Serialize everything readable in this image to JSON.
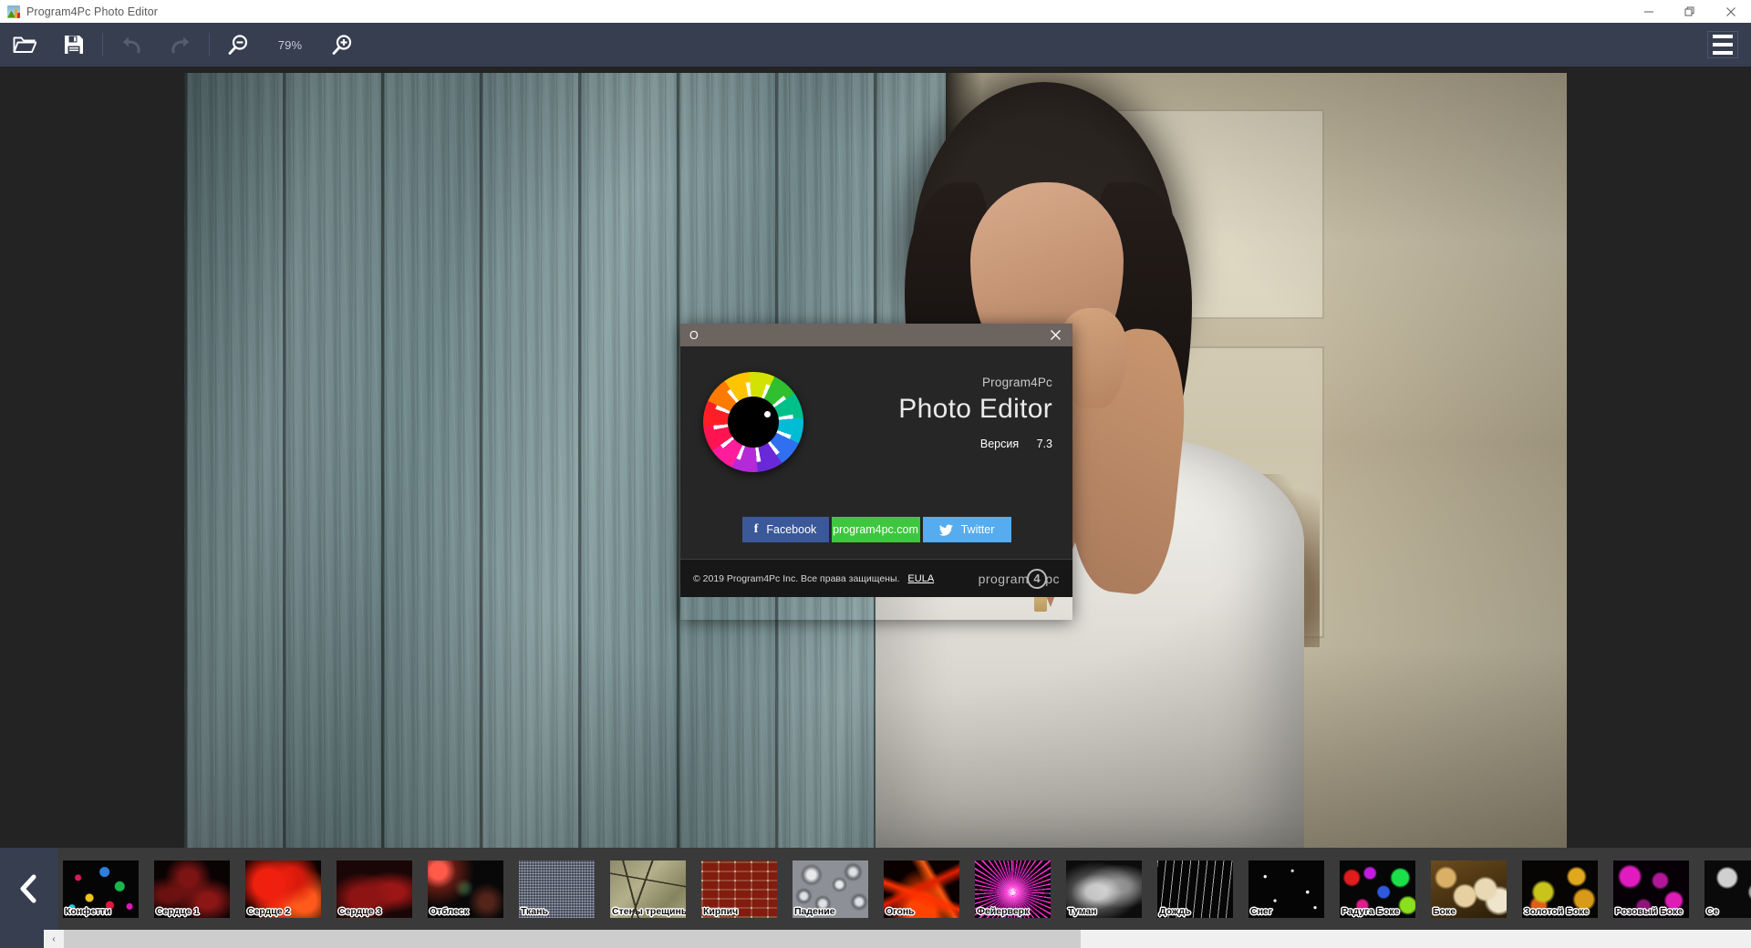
{
  "window": {
    "title": "Program4Pc Photo Editor",
    "icon": "photo-app-icon",
    "controls": {
      "minimize": "minimize-icon",
      "restore": "restore-icon",
      "close": "close-icon"
    }
  },
  "toolbar": {
    "open_label": "folder-open-icon",
    "save_label": "save-icon",
    "undo_label": "undo-icon",
    "redo_label": "redo-icon",
    "zoom_out_label": "zoom-out-icon",
    "zoom_level": "79%",
    "zoom_in_label": "zoom-in-icon",
    "menu_label": "hamburger-menu-icon"
  },
  "dialog": {
    "title": "О",
    "close_label": "✕",
    "logo": "color-wheel-eye-icon",
    "brand_small": "Program4Pc",
    "brand_big": "Photo Editor",
    "version_label": "Версия",
    "version_value": "7.3",
    "buttons": [
      {
        "name": "facebook",
        "label": "Facebook",
        "glyph": "f",
        "color": "#3b5998"
      },
      {
        "name": "website",
        "label": "program4pc.com",
        "glyph": "",
        "color": "#3ec73e"
      },
      {
        "name": "twitter",
        "label": "Twitter",
        "glyph": "🐦",
        "color": "#55acee"
      }
    ],
    "copyright": "© 2019 Program4Pc Inc. Все права защищены.",
    "eula": "EULA",
    "footer_logo_left": "program",
    "footer_logo_num": "4",
    "footer_logo_right": "pc"
  },
  "filmstrip": {
    "prev_label": "chevron-left-icon",
    "thumbs": [
      {
        "label": "Конфетти",
        "art": "t-confetti"
      },
      {
        "label": "Сердце 1",
        "art": "t-heart1"
      },
      {
        "label": "Сердце 2",
        "art": "t-heart2"
      },
      {
        "label": "Сердце 3",
        "art": "t-heart3"
      },
      {
        "label": "Отблеск",
        "art": "t-flare"
      },
      {
        "label": "Ткань",
        "art": "t-fabric"
      },
      {
        "label": "Стены трещины",
        "art": "t-cracked"
      },
      {
        "label": "Кирпич",
        "art": "t-brick"
      },
      {
        "label": "Падение",
        "art": "t-drops"
      },
      {
        "label": "Огонь",
        "art": "t-fire"
      },
      {
        "label": "Фейерверк",
        "art": "t-firework"
      },
      {
        "label": "Туман",
        "art": "t-fog"
      },
      {
        "label": "Дождь",
        "art": "t-rain"
      },
      {
        "label": "Снег",
        "art": "t-snow"
      },
      {
        "label": "Радуга Боке",
        "art": "t-rainbow-bokeh"
      },
      {
        "label": "Боке",
        "art": "t-bokeh"
      },
      {
        "label": "Золотой Боке",
        "art": "t-gold-bokeh"
      },
      {
        "label": "Розовый Боке",
        "art": "t-pink-bokeh"
      },
      {
        "label": "Се",
        "art": "t-gray-bokeh"
      }
    ]
  },
  "scrollbar": {
    "left_arrow": "‹"
  },
  "colors": {
    "toolbar_bg": "#363e50",
    "workspace_bg": "#232323",
    "dialog_bg": "#262626",
    "dialog_titlebar": "#6b645f",
    "filmstrip_bg": "#3a3a3a",
    "facebook_blue": "#3b5998",
    "site_green": "#3ec73e",
    "twitter_blue": "#55acee"
  }
}
